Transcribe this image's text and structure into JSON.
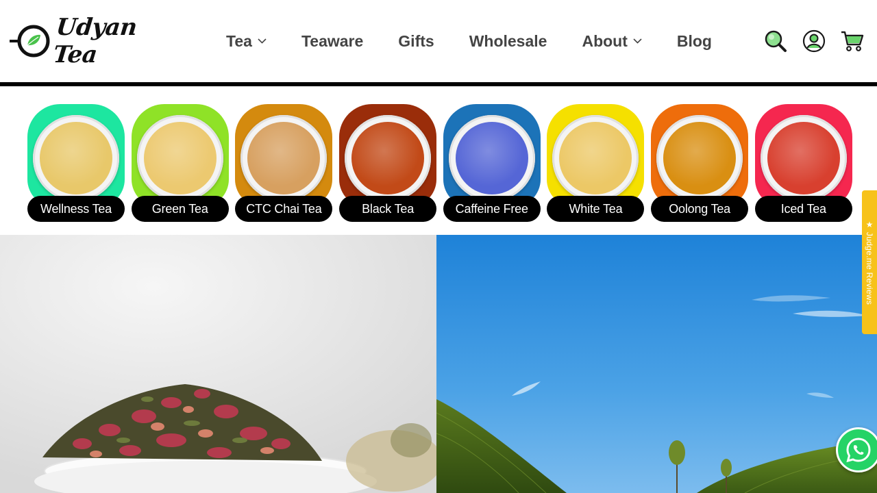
{
  "brand": {
    "name": "Udyan Tea",
    "accent": "#2fb54a"
  },
  "nav": {
    "items": [
      {
        "label": "Tea",
        "has_dropdown": true
      },
      {
        "label": "Teaware",
        "has_dropdown": false
      },
      {
        "label": "Gifts",
        "has_dropdown": false
      },
      {
        "label": "Wholesale",
        "has_dropdown": false
      },
      {
        "label": "About",
        "has_dropdown": true
      },
      {
        "label": "Blog",
        "has_dropdown": false
      }
    ]
  },
  "header_icons": [
    "search-icon",
    "account-icon",
    "cart-icon"
  ],
  "categories": [
    {
      "label": "Wellness Tea",
      "bg": "#1de6a0",
      "liquid": "#e8c86a"
    },
    {
      "label": "Green Tea",
      "bg": "#8fe227",
      "liquid": "#ecc970"
    },
    {
      "label": "CTC Chai Tea",
      "bg": "#d48a0e",
      "liquid": "#d7a060"
    },
    {
      "label": "Black Tea",
      "bg": "#9a2d0a",
      "liquid": "#c24a18"
    },
    {
      "label": "Caffeine Free",
      "bg": "#1c73b8",
      "liquid": "#5566d6"
    },
    {
      "label": "White Tea",
      "bg": "#f5e000",
      "liquid": "#ecc866"
    },
    {
      "label": "Oolong Tea",
      "bg": "#ee6d0b",
      "liquid": "#d98f12"
    },
    {
      "label": "Iced Tea",
      "bg": "#f5274f",
      "liquid": "#d8402f"
    }
  ],
  "side_tab": {
    "label": "★ Judge.me Reviews",
    "color": "#f7c21a"
  },
  "whatsapp": {
    "icon": "whatsapp-icon",
    "color": "#25d366"
  }
}
